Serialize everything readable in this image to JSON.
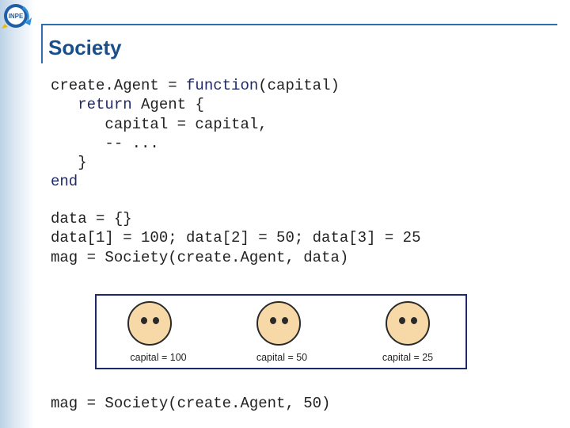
{
  "slide": {
    "title": "Society"
  },
  "code": {
    "block1": {
      "l1_a": "create.Agent = ",
      "l1_kw": "function",
      "l1_b": "(capital)",
      "l2_kw": "   return",
      "l2_b": " Agent {",
      "l3": "      capital = capital,",
      "l4": "      -- ...",
      "l5": "   }",
      "l6_kw": "end"
    },
    "block2": {
      "l1": "data = {}",
      "l2": "data[1] = 100; data[2] = 50; data[3] = 25",
      "l3": "mag = Society(create.Agent, data)"
    },
    "block3": {
      "l1": "mag = Society(create.Agent, 50)"
    }
  },
  "agents": [
    {
      "label": "capital = 100"
    },
    {
      "label": "capital = 50"
    },
    {
      "label": "capital = 25"
    }
  ],
  "icons": {
    "logo": "inpe-logo-icon",
    "face": "smiley-face-icon"
  },
  "colors": {
    "title": "#1a4f8a",
    "keyword": "#1f2a6b",
    "frame": "#2f6fb0",
    "box_border": "#1c2a6a",
    "face_fill": "#f7d9a8"
  }
}
